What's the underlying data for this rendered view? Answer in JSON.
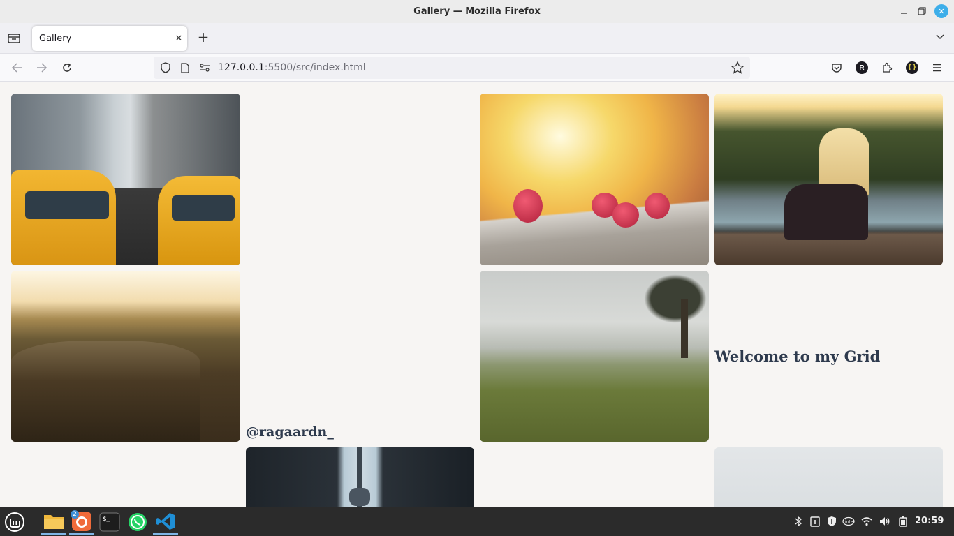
{
  "window": {
    "title": "Gallery — Mozilla Firefox"
  },
  "tabs": [
    {
      "label": "Gallery"
    }
  ],
  "url": {
    "host": "127.0.0.1",
    "rest": ":5500/src/index.html"
  },
  "content": {
    "handle": "@ragaardn_",
    "welcome": "Welcome to my Grid"
  },
  "taskbar": {
    "firefox_badge": "2",
    "clock": "20:59"
  },
  "colors": {
    "page_bg": "#f7f5f3",
    "caption": "#2e3a4d",
    "taskbar": "#2b2b2b",
    "close_button": "#3daee9"
  }
}
